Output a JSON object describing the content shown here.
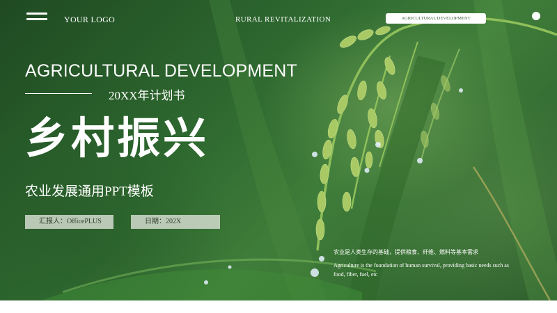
{
  "header": {
    "logo_text": "YOUR LOGO",
    "center_text": "RURAL REVITALIZATION",
    "badge_text": "AGRICULTURAL DEVELOPMENT"
  },
  "hero": {
    "title_en": "AGRICULTURAL DEVELOPMENT",
    "plan_text": "20XX年计划书",
    "title_cn": "乡村振兴",
    "subtitle": "农业发展通用PPT模板"
  },
  "info": {
    "reporter": "汇报人：OfficePLUS",
    "date": "日期：202X"
  },
  "description": {
    "cn": "农业是人类生存的基础，提供粮食、纤维、燃料等基本需求",
    "en": "Agriculture is the foundation of human survival, providing basic needs such as food, fiber, fuel, etc"
  },
  "colors": {
    "background_dark": "#1f4a22",
    "background_mid": "#3f7d3a",
    "tag_bg": "#cdd7c8",
    "text": "#ffffff"
  }
}
